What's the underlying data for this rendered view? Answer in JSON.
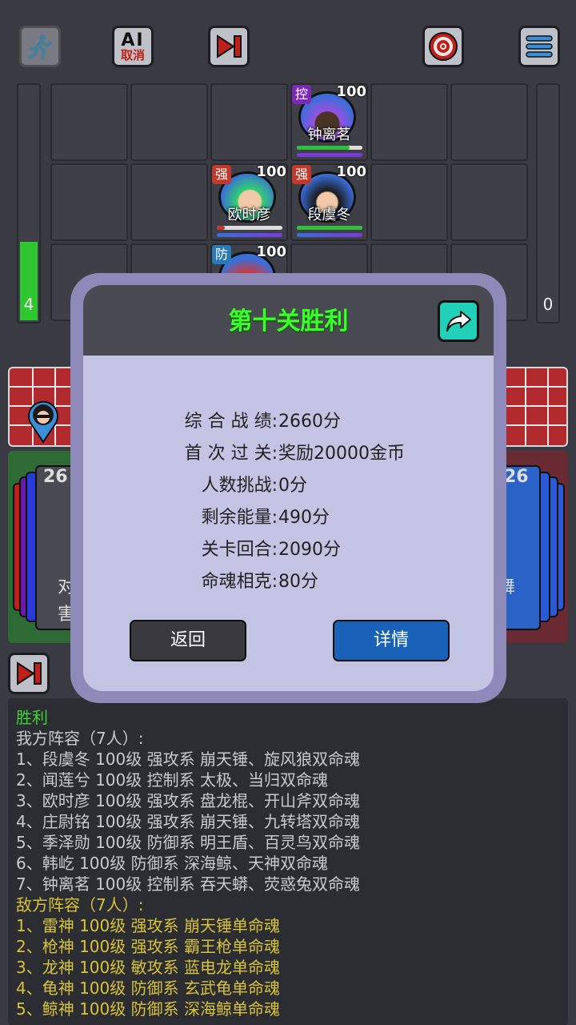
{
  "top_bar": {
    "ai_label_top": "AI",
    "ai_label_bottom": "取消"
  },
  "sidebar": {
    "left_energy": "4",
    "left_energy_fraction": 0.33,
    "right_energy": "0"
  },
  "board": {
    "heroes": [
      {
        "tag": "控",
        "tag_color": "#7b2ab5",
        "level": "100",
        "name": "钟离茗",
        "hair": "#9a4fe0"
      },
      {
        "tag": "强",
        "tag_color": "#c0392b",
        "level": "100",
        "name": "欧时彦",
        "hair": "#32d06e"
      },
      {
        "tag": "强",
        "tag_color": "#c0392b",
        "level": "100",
        "name": "段虞冬",
        "hair": "#1a1a1a"
      },
      {
        "tag": "防",
        "tag_color": "#2a7ab5",
        "level": "100",
        "name": "",
        "hair": "#d23a3a"
      }
    ]
  },
  "side_cards": {
    "left_count": "26",
    "right_count": "26",
    "left_text_1": "对",
    "left_text_2": "害",
    "right_text_1": "舞"
  },
  "modal": {
    "title": "第十关胜利",
    "rows": [
      {
        "label": "综 合 战 绩:",
        "value": "2660分"
      },
      {
        "label": "首 次 过 关:",
        "value": "奖励20000金币"
      },
      {
        "label": "人数挑战:",
        "value": "0分"
      },
      {
        "label": "剩余能量:",
        "value": "490分"
      },
      {
        "label": "关卡回合:",
        "value": "2090分"
      },
      {
        "label": "命魂相克:",
        "value": "80分"
      }
    ],
    "back_label": "返回",
    "detail_label": "详情"
  },
  "log": {
    "lines": [
      {
        "text": "胜利",
        "color": "#3fd13a"
      },
      {
        "text": "我方阵容（7人）:",
        "color": "#c9c9cf"
      },
      {
        "text": "1、段虞冬 100级 强攻系 崩天锤、旋风狼双命魂",
        "color": "#c9c9cf"
      },
      {
        "text": "2、闻莲兮 100级 控制系 太极、当归双命魂",
        "color": "#c9c9cf"
      },
      {
        "text": "3、欧时彦 100级 强攻系 盘龙棍、开山斧双命魂",
        "color": "#c9c9cf"
      },
      {
        "text": "4、庄尉铭 100级 强攻系 崩天锤、九转塔双命魂",
        "color": "#c9c9cf"
      },
      {
        "text": "5、季泽勋 100级 防御系 明王盾、百灵鸟双命魂",
        "color": "#c9c9cf"
      },
      {
        "text": "6、韩屹 100级 防御系 深海鲸、天神双命魂",
        "color": "#c9c9cf"
      },
      {
        "text": "7、钟离茗 100级 控制系 吞天蟒、荧惑兔双命魂",
        "color": "#c9c9cf"
      },
      {
        "text": "敌方阵容（7人）:",
        "color": "#d8c23a"
      },
      {
        "text": "1、雷神 100级 强攻系 崩天锤单命魂",
        "color": "#d8c23a"
      },
      {
        "text": "2、枪神 100级 强攻系 霸王枪单命魂",
        "color": "#d8c23a"
      },
      {
        "text": "3、龙神 100级 敏攻系 蓝电龙单命魂",
        "color": "#d8c23a"
      },
      {
        "text": "4、龟神 100级 防御系 玄武龟单命魂",
        "color": "#d8c23a"
      },
      {
        "text": "5、鲸神 100级 防御系 深海鲸单命魂",
        "color": "#d8c23a"
      }
    ]
  }
}
